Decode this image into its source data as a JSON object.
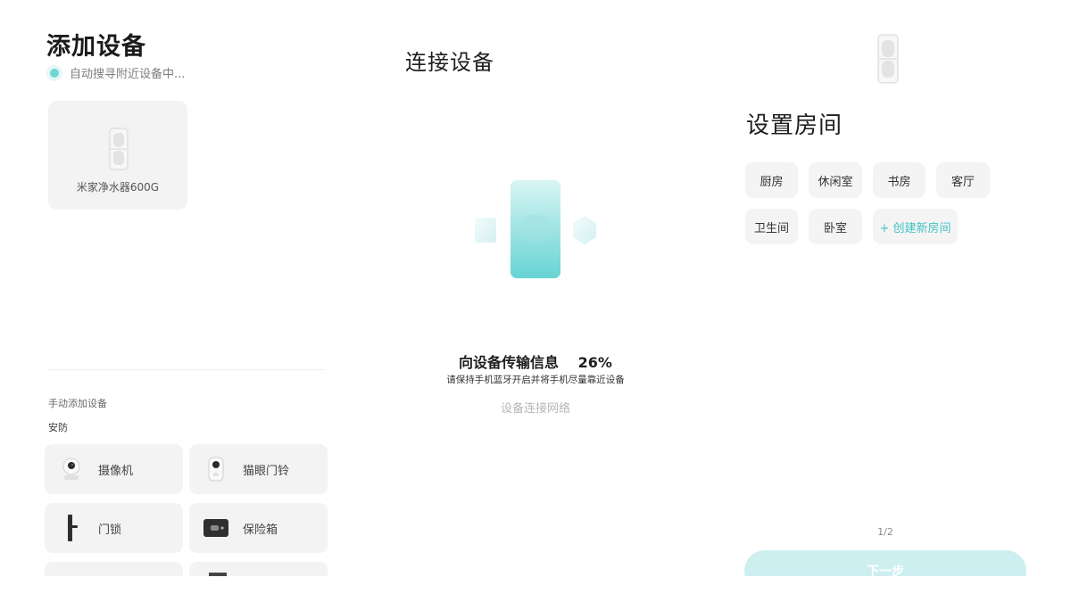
{
  "left": {
    "title": "添加设备",
    "searching": "自动搜寻附近设备中...",
    "found_device": "米家净水器600G",
    "manual_label": "手动添加设备",
    "category_label": "安防",
    "items": [
      {
        "label": "摄像机",
        "icon": "camera-icon"
      },
      {
        "label": "猫眼门铃",
        "icon": "peephole-doorbell-icon"
      },
      {
        "label": "门锁",
        "icon": "door-lock-icon"
      },
      {
        "label": "保险箱",
        "icon": "safe-box-icon"
      }
    ]
  },
  "middle": {
    "title": "连接设备",
    "progress_label": "向设备传输信息",
    "progress_percent": "26%",
    "progress_value": 26,
    "hint": "请保持手机蓝牙开启并将手机尽量靠近设备",
    "next_step": "设备连接网络"
  },
  "right": {
    "title": "设置房间",
    "rooms": [
      "厨房",
      "休闲室",
      "书房",
      "客厅",
      "卫生间",
      "卧室"
    ],
    "create_room": "+ 创建新房间",
    "page_indicator": "1/2",
    "next_button": "下一步"
  },
  "colors": {
    "accent": "#41c2c2",
    "accent_light": "#cdeff0",
    "card_bg": "#f3f3f3"
  }
}
